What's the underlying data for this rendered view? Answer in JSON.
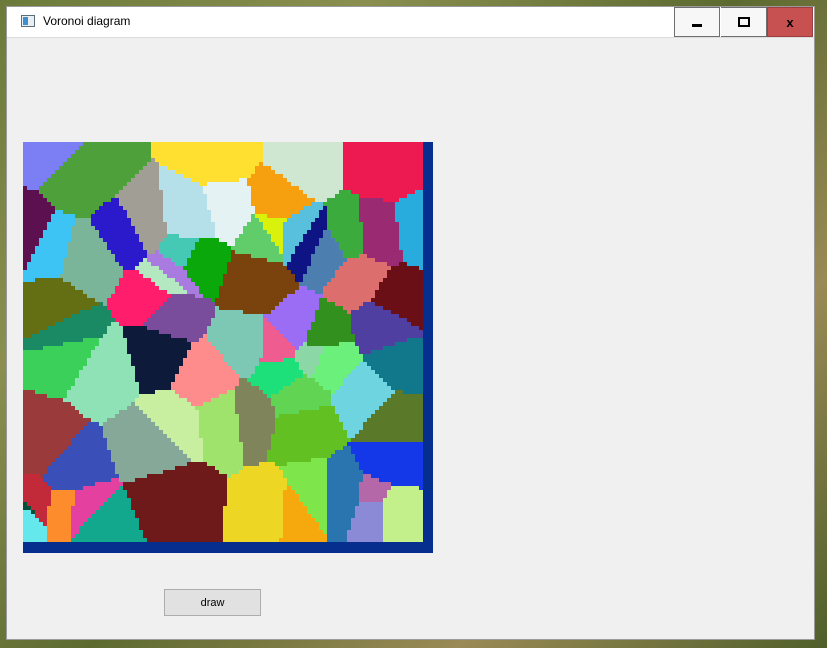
{
  "window": {
    "title": "Voronoi diagram",
    "controls": {
      "minimize_icon": "minimize-icon",
      "maximize_icon": "maximize-icon",
      "close_icon": "close-icon",
      "close_label": "x"
    }
  },
  "canvas": {
    "background_color": "#062e8f",
    "cell_colors": [
      "#64e8ec",
      "#a19e96",
      "#8bd8a6",
      "#86a898",
      "#6cf07c",
      "#62d454",
      "#3aab3c",
      "#c8eea0",
      "#cfe6d0",
      "#9b6cf4",
      "#1437e8",
      "#3ad05a",
      "#5a7a2a",
      "#1ee07a",
      "#c4f08c",
      "#a97be0",
      "#dc6e6e",
      "#7ab59a",
      "#0aa80a",
      "#10788a",
      "#7ee64a",
      "#3ec4f4",
      "#7cc8b4",
      "#b5e0ea",
      "#ec1a50",
      "#b4e8c0",
      "#f5a90c",
      "#e4f2f4",
      "#45c9b4",
      "#7a4d9c",
      "#0d1a3a",
      "#60cc6a",
      "#4f3fa0",
      "#6dd4e0",
      "#ee5c90",
      "#9fe26c",
      "#6b0f16",
      "#0e1484",
      "#7a430e",
      "#ff1d6c",
      "#2a74b0",
      "#3a50b8",
      "#646e12",
      "#4da03a",
      "#28acde",
      "#f6a010",
      "#ff8c8c",
      "#e440a0",
      "#b468a8",
      "#8a8ad6",
      "#4c7fb0",
      "#5d1050",
      "#7c7ef4",
      "#d8f20c",
      "#32901e",
      "#58c0dc",
      "#9a2a72",
      "#6e1a1a",
      "#1a8a64",
      "#05503a",
      "#eed624",
      "#c22a3a",
      "#12a88e",
      "#7f845a",
      "#2a1acc",
      "#8ee2b6",
      "#9a3a3a",
      "#62c022",
      "#ffe030",
      "#fd8c2c"
    ]
  },
  "draw_button": {
    "label": "draw"
  }
}
